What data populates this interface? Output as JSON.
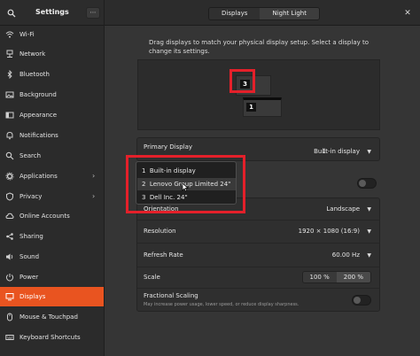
{
  "header": {
    "title": "Settings",
    "menu_label": "⋯",
    "tabs": [
      {
        "label": "Displays",
        "active": false
      },
      {
        "label": "Night Light",
        "active": true
      }
    ],
    "close_label": "✕"
  },
  "sidebar": {
    "items": [
      {
        "label": "Wi-Fi",
        "icon": "wifi-icon"
      },
      {
        "label": "Network",
        "icon": "network-icon"
      },
      {
        "label": "Bluetooth",
        "icon": "bluetooth-icon"
      },
      {
        "label": "Background",
        "icon": "background-icon"
      },
      {
        "label": "Appearance",
        "icon": "appearance-icon"
      },
      {
        "label": "Notifications",
        "icon": "notifications-icon"
      },
      {
        "label": "Search",
        "icon": "search-icon"
      },
      {
        "label": "Applications",
        "icon": "applications-icon",
        "chevron": "›"
      },
      {
        "label": "Privacy",
        "icon": "privacy-icon",
        "chevron": "›"
      },
      {
        "label": "Online Accounts",
        "icon": "online-accounts-icon"
      },
      {
        "label": "Sharing",
        "icon": "sharing-icon"
      },
      {
        "label": "Sound",
        "icon": "sound-icon"
      },
      {
        "label": "Power",
        "icon": "power-icon"
      },
      {
        "label": "Displays",
        "icon": "displays-icon",
        "active": true
      },
      {
        "label": "Mouse & Touchpad",
        "icon": "mouse-icon"
      },
      {
        "label": "Keyboard Shortcuts",
        "icon": "keyboard-icon"
      }
    ],
    "active_color": "#e95420"
  },
  "main": {
    "hint": "Drag displays to match your physical display setup. Select a display to change its settings.",
    "arrangement": {
      "monitor_a_badge": "3",
      "monitor_b_badge": "1"
    },
    "primary": {
      "label": "Primary Display",
      "value_num": "1",
      "value": "Built-in display",
      "caret": "▼"
    },
    "settings": {
      "orientation": {
        "label": "Orientation",
        "value": "Landscape",
        "caret": "▼"
      },
      "resolution": {
        "label": "Resolution",
        "value": "1920 × 1080 (16:9)",
        "caret": "▼"
      },
      "refresh": {
        "label": "Refresh Rate",
        "value": "60.00 Hz",
        "caret": "▼"
      },
      "scale": {
        "label": "Scale",
        "options": [
          "100 %",
          "200 %"
        ],
        "selected": "200 %"
      },
      "fractional": {
        "label": "Fractional Scaling",
        "subtitle": "May increase power usage, lower speed, or reduce display sharpness.",
        "enabled": false
      }
    },
    "dropdown": {
      "items": [
        {
          "num": "1",
          "label": "Built-in display"
        },
        {
          "num": "2",
          "label": "Lenovo Group Limited 24\"",
          "hover": true
        },
        {
          "num": "3",
          "label": "Dell Inc. 24\""
        }
      ]
    }
  },
  "annotation_color": "#e4202a"
}
